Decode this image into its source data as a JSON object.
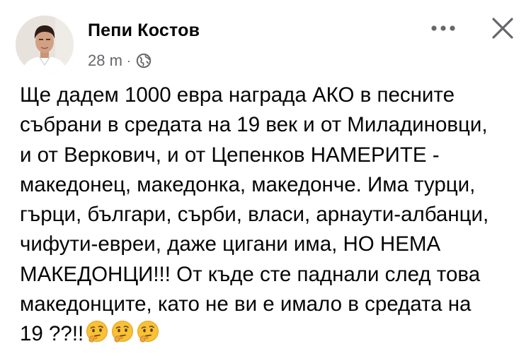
{
  "post": {
    "author": "Пепи Костов",
    "time": "28 m",
    "separator": "·",
    "privacy_icon": "globe-icon",
    "menu_icon": "more-options-icon",
    "close_icon": "close-icon",
    "body": "Ще дадем 1000 евра награда АКО в песните\nсъбрани в средата на 19 век и от Миладиновци,\nи от Веркович, и от Цепенков НАМЕРИТЕ -\nмакедонец, македонка, македонче. Има турци,\nгърци, българи, сърби, власи, арнаути-албанци,\nчифути-евреи, даже цигани има, НО НЕМА\nМАКЕДОНЦИ!!! От къде сте паднали след това\nмакедонците, като не ви е имало в средата на\n19 ??!!",
    "emojis": [
      "thinking-face-emoji",
      "thinking-face-emoji",
      "thinking-face-emoji"
    ]
  },
  "colors": {
    "text": "#050505",
    "secondary_text": "#65676b",
    "icon": "#65676b",
    "emoji": "#f8c136"
  }
}
